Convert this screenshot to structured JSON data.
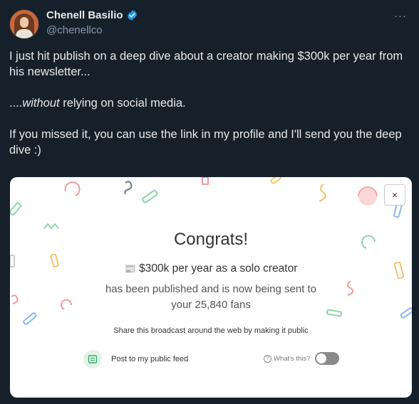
{
  "author": {
    "display_name": "Chenell Basilio",
    "handle": "@chenellco",
    "verified": true
  },
  "icons": {
    "more": "more-options-icon",
    "verified": "verified-badge-icon",
    "close": "close-icon",
    "feed": "feed-icon",
    "help": "question-icon"
  },
  "tweet": {
    "paragraph_1": "I just hit publish on a deep dive about a creator making $300k per year from his newsletter...",
    "paragraph_2_prefix": "....",
    "paragraph_2_emphasis": "without",
    "paragraph_2_suffix": " relying on social media.",
    "paragraph_3": "If you missed it, you can use the link in my profile and I'll send you the deep dive :)"
  },
  "card": {
    "close_label": "×",
    "title": "Congrats!",
    "post_title": "$300k per year as a solo creator",
    "message_line_1": "has been published and is now being sent to",
    "message_line_2": "your 25,840 fans",
    "share_text": "Share this broadcast around the web by making it public",
    "feed_option_label": "Post to my public feed",
    "help_label": "What's this?",
    "public_feed_enabled": false
  },
  "colors": {
    "background": "#15202b",
    "text_primary": "#e7e9ea",
    "text_secondary": "#8b98a5",
    "verified_blue": "#1d9bf0",
    "confetti": [
      "#f29b9b",
      "#8fd3a8",
      "#f5c36b",
      "#8ab8f0",
      "#f7b6c8"
    ]
  }
}
